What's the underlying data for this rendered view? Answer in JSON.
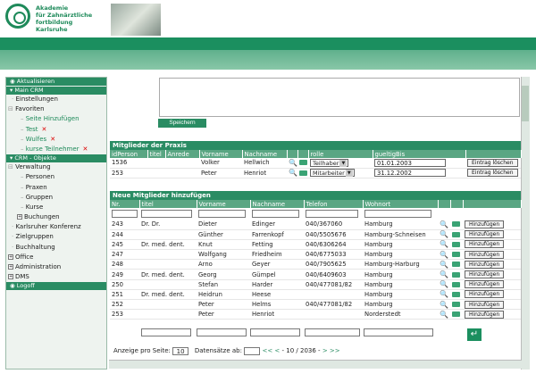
{
  "brand": {
    "logo_lines": [
      "Akademie",
      "für Zahnärztliche",
      "fortbildung",
      "Karlsruhe"
    ],
    "primary_color": "#1b8f5f",
    "accent_color": "#2a8c63"
  },
  "sidebar": {
    "aktualisieren": "Aktualisieren",
    "main_crm": "Main CRM",
    "einstellungen": "Einstellungen",
    "favoriten": "Favoriten",
    "seite_hinzufuegen": "Seite Hinzufügen",
    "fav_test": "Test",
    "fav_wulfes": "Wulfes",
    "fav_kurse": "kurse Teilnehmer",
    "crm_objekte": "CRM - Objekte",
    "verwaltung": "Verwaltung",
    "personen": "Personen",
    "praxen": "Praxen",
    "gruppen": "Gruppen",
    "kurse": "Kurse",
    "buchungen": "Buchungen",
    "karlsruher_konferenz": "Karlsruher Konferenz",
    "zielgruppen": "Zielgruppen",
    "buchhaltung": "Buchhaltung",
    "office": "Office",
    "administration": "Administration",
    "dms": "DMS",
    "logoff": "Logoff",
    "remove_symbol": "✕"
  },
  "editor": {
    "save_label": "Speichern"
  },
  "mitglieder": {
    "title": "Mitglieder der Praxis",
    "headers": [
      "idPerson",
      "titel",
      "Anrede",
      "Vorname",
      "Nachname",
      "rolle",
      "gueltigBis"
    ],
    "rows": [
      {
        "id": "1536",
        "titel": "",
        "anrede": "",
        "vorname": "Volker",
        "nachname": "Hellwich",
        "rolle": "Teilhaber",
        "gueltig": "01.01.2003",
        "btn": "Eintrag löschen"
      },
      {
        "id": "253",
        "titel": "",
        "anrede": "",
        "vorname": "Peter",
        "nachname": "Henriot",
        "rolle": "Mitarbeiter",
        "gueltig": "31.12.2002",
        "btn": "Eintrag löschen"
      }
    ]
  },
  "neue": {
    "title": "Neue Mitglieder hinzufügen",
    "headers": [
      "Nr.",
      "titel",
      "Vorname",
      "Nachname",
      "Telefon",
      "Wohnort"
    ],
    "add_label": "Hinzufügen",
    "rows": [
      {
        "nr": "243",
        "titel": "Dr. Dr.",
        "vorname": "Dieter",
        "nachname": "Edinger",
        "telefon": "040/367060",
        "wohnort": "Hamburg"
      },
      {
        "nr": "244",
        "titel": "",
        "vorname": "Günther",
        "nachname": "Farrenkopf",
        "telefon": "040/5505676",
        "wohnort": "Hamburg-Schneisen"
      },
      {
        "nr": "245",
        "titel": "Dr. med. dent.",
        "vorname": "Knut",
        "nachname": "Fetting",
        "telefon": "040/6306264",
        "wohnort": "Hamburg"
      },
      {
        "nr": "247",
        "titel": "",
        "vorname": "Wolfgang",
        "nachname": "Friedheim",
        "telefon": "040/6775033",
        "wohnort": "Hamburg"
      },
      {
        "nr": "248",
        "titel": "",
        "vorname": "Arno",
        "nachname": "Geyer",
        "telefon": "040/7905625",
        "wohnort": "Hamburg-Harburg"
      },
      {
        "nr": "249",
        "titel": "Dr. med. dent.",
        "vorname": "Georg",
        "nachname": "Gümpel",
        "telefon": "040/6409603",
        "wohnort": "Hamburg"
      },
      {
        "nr": "250",
        "titel": "",
        "vorname": "Stefan",
        "nachname": "Harder",
        "telefon": "040/477081/82",
        "wohnort": "Hamburg"
      },
      {
        "nr": "251",
        "titel": "Dr. med. dent.",
        "vorname": "Heidrun",
        "nachname": "Heese",
        "telefon": "",
        "wohnort": "Hamburg"
      },
      {
        "nr": "252",
        "titel": "",
        "vorname": "Peter",
        "nachname": "Helms",
        "telefon": "040/477081/82",
        "wohnort": "Hamburg"
      },
      {
        "nr": "253",
        "titel": "",
        "vorname": "Peter",
        "nachname": "Henriot",
        "telefon": "",
        "wohnort": "Norderstedt"
      }
    ]
  },
  "pager": {
    "per_page_label": "Anzeige pro Seite:",
    "per_page_value": "10",
    "records_label": "Datensätze ab:",
    "first": "<<",
    "prev": "<",
    "range": "- 10 / 2036 -",
    "next": ">",
    "last": ">>"
  },
  "icons": {
    "search": "🔍",
    "enter": "↵"
  }
}
